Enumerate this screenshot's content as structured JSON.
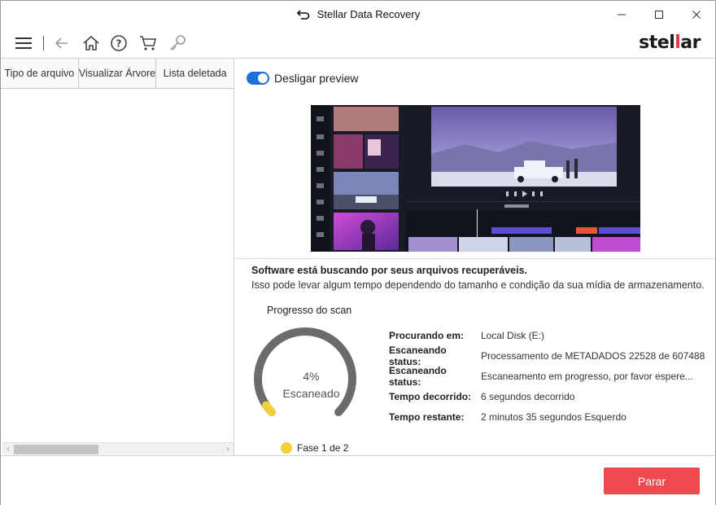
{
  "window": {
    "title": "Stellar Data Recovery",
    "controls": [
      "minimize-icon",
      "maximize-icon",
      "close-icon"
    ]
  },
  "toolbar": {
    "icons": [
      "menu-icon",
      "back-arrow-icon",
      "home-icon",
      "help-icon",
      "cart-icon",
      "key-icon"
    ],
    "brand_prefix": "stel",
    "brand_accent": "l",
    "brand_suffix": "ar",
    "brand_color": "#e8373c"
  },
  "left_panel": {
    "tabs": [
      {
        "label": "Tipo de arquivo"
      },
      {
        "label": "Visualizar Árvore"
      },
      {
        "label": "Lista deletada"
      }
    ]
  },
  "preview": {
    "toggle_label": "Desligar preview",
    "toggle_on": true,
    "toggle_color": "#1f6fd6"
  },
  "scan": {
    "message_title": "Software está buscando por seus arquivos recuperáveis.",
    "message_detail": "Isso pode levar algum tempo dependendo do tamanho e condição da sua mídia de armazenamento.",
    "progress_title": "Progresso do scan",
    "progress_percent": 4,
    "progress_text": "4%",
    "progress_label": "Escaneado",
    "phase_text": "Fase 1 de 2",
    "phase_color": "#f5cf3a",
    "status": [
      {
        "key": "Procurando em:",
        "value": "Local Disk (E:)"
      },
      {
        "key": "Escaneando status:",
        "value": "Processamento de METADADOS 22528 de 607488"
      },
      {
        "key": "Escaneando status:",
        "value": "Escaneamento em progresso, por favor espere..."
      },
      {
        "key": "Tempo decorrido:",
        "value": "6 segundos decorrido"
      },
      {
        "key": "Tempo restante:",
        "value": "2 minutos 35 segundos Esquerdo"
      }
    ]
  },
  "footer": {
    "stop_label": "Parar",
    "stop_color": "#ef4a4f"
  }
}
